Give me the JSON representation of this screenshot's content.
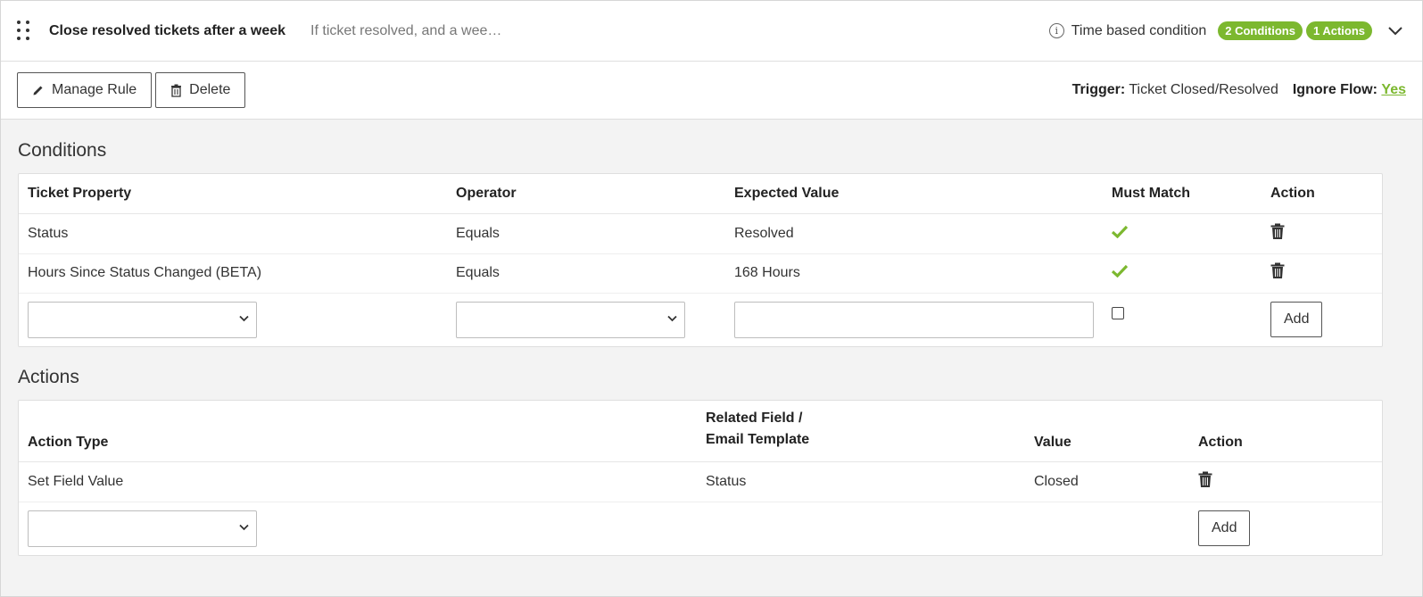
{
  "header": {
    "title": "Close resolved tickets after a week",
    "summary": "If ticket resolved, and a wee…",
    "time_condition_label": "Time based condition",
    "conditions_badge": "2 Conditions",
    "actions_badge": "1 Actions"
  },
  "toolbar": {
    "manage_label": "Manage Rule",
    "delete_label": "Delete",
    "trigger_label": "Trigger:",
    "trigger_value": "Ticket Closed/Resolved",
    "ignore_flow_label": "Ignore Flow:",
    "ignore_flow_value": "Yes"
  },
  "conditions": {
    "title": "Conditions",
    "headers": [
      "Ticket Property",
      "Operator",
      "Expected Value",
      "Must Match",
      "Action"
    ],
    "rows": [
      {
        "property": "Status",
        "operator": "Equals",
        "value": "Resolved",
        "must_match": true
      },
      {
        "property": "Hours Since Status Changed (BETA)",
        "operator": "Equals",
        "value": "168 Hours",
        "must_match": true
      }
    ],
    "add_label": "Add"
  },
  "actions": {
    "title": "Actions",
    "headers": [
      "Action Type",
      "Related Field /",
      "Email Template",
      "Value",
      "Action"
    ],
    "rows": [
      {
        "type": "Set Field Value",
        "field": "Status",
        "value": "Closed"
      }
    ],
    "add_label": "Add"
  },
  "colors": {
    "accent": "#7cb82f",
    "background": "#f3f3f3"
  },
  "icons": [
    "drag-handle-icon",
    "info-icon",
    "chevron-down-icon",
    "pencil-icon",
    "trash-icon",
    "check-icon"
  ]
}
